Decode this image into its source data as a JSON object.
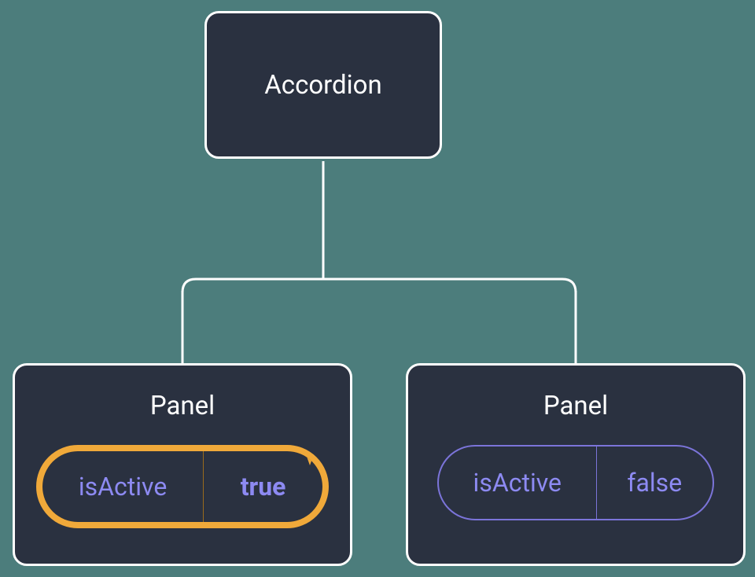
{
  "root": {
    "label": "Accordion"
  },
  "panels": [
    {
      "label": "Panel",
      "prop_key": "isActive",
      "prop_value": "true",
      "highlighted": true
    },
    {
      "label": "Panel",
      "prop_key": "isActive",
      "prop_value": "false",
      "highlighted": false
    }
  ],
  "colors": {
    "node_bg": "#2a3140",
    "node_border": "#ffffff",
    "background": "#4c7d7c",
    "accent": "#8d8af2",
    "highlight": "#f0a93a"
  }
}
